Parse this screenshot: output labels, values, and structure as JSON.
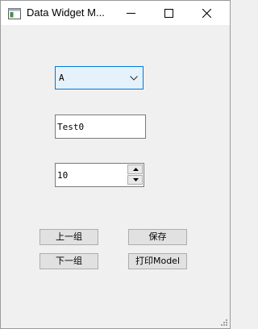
{
  "window": {
    "title": "Data Widget M...",
    "controls": {
      "minimize": "minimize-icon",
      "maximize": "maximize-icon",
      "close": "close-icon"
    },
    "app_icon": "window-icon"
  },
  "form": {
    "combo": {
      "selected": "A",
      "arrow_icon": "chevron-down-icon"
    },
    "line_edit": {
      "value": "Test0"
    },
    "spin_box": {
      "value": "10",
      "up_icon": "arrow-up-icon",
      "down_icon": "arrow-down-icon"
    }
  },
  "buttons": {
    "prev": "上一组",
    "save": "保存",
    "next": "下一组",
    "print": "打印Model"
  },
  "colors": {
    "window_bg": "#f0f0f0",
    "titlebar_bg": "#ffffff",
    "combo_bg": "#e5f1fb",
    "focus_border": "#0078d7",
    "button_bg": "#e1e1e1"
  }
}
